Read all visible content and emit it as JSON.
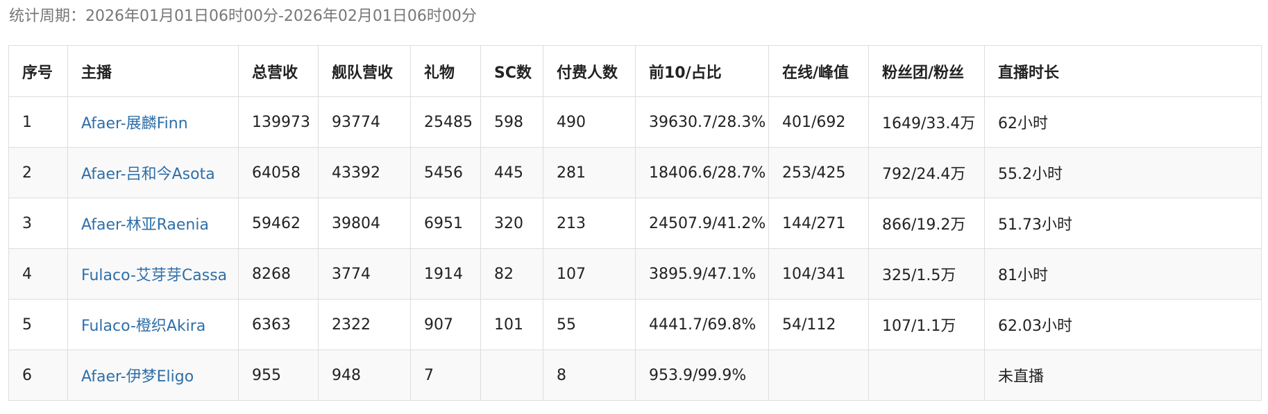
{
  "period_text": "统计周期：2026年01月01日06时00分-2026年02月01日06时00分",
  "columns": [
    "序号",
    "主播",
    "总营收",
    "舰队营收",
    "礼物",
    "SC数",
    "付费人数",
    "前10/占比",
    "在线/峰值",
    "粉丝团/粉丝",
    "直播时长"
  ],
  "rows": [
    [
      "1",
      "Afaer-展麟Finn",
      "139973",
      "93774",
      "25485",
      "598",
      "490",
      "39630.7/28.3%",
      "401/692",
      "1649/33.4万",
      "62小时"
    ],
    [
      "2",
      "Afaer-吕和今Asota",
      "64058",
      "43392",
      "5456",
      "445",
      "281",
      "18406.6/28.7%",
      "253/425",
      "792/24.4万",
      "55.2小时"
    ],
    [
      "3",
      "Afaer-林亚Raenia",
      "59462",
      "39804",
      "6951",
      "320",
      "213",
      "24507.9/41.2%",
      "144/271",
      "866/19.2万",
      "51.73小时"
    ],
    [
      "4",
      "Fulaco-艾芽芽Cassa",
      "8268",
      "3774",
      "1914",
      "82",
      "107",
      "3895.9/47.1%",
      "104/341",
      "325/1.5万",
      "81小时"
    ],
    [
      "5",
      "Fulaco-橙织Akira",
      "6363",
      "2322",
      "907",
      "101",
      "55",
      "4441.7/69.8%",
      "54/112",
      "107/1.1万",
      "62.03小时"
    ],
    [
      "6",
      "Afaer-伊梦Eligo",
      "955",
      "948",
      "7",
      "",
      "8",
      "953.9/99.9%",
      "",
      "",
      "未直播"
    ]
  ],
  "colors": {
    "link": "#2f6fa8",
    "header_text": "#222222",
    "period_text": "#777777",
    "border": "#dddddd",
    "row_alt": "#f9f9f9"
  }
}
